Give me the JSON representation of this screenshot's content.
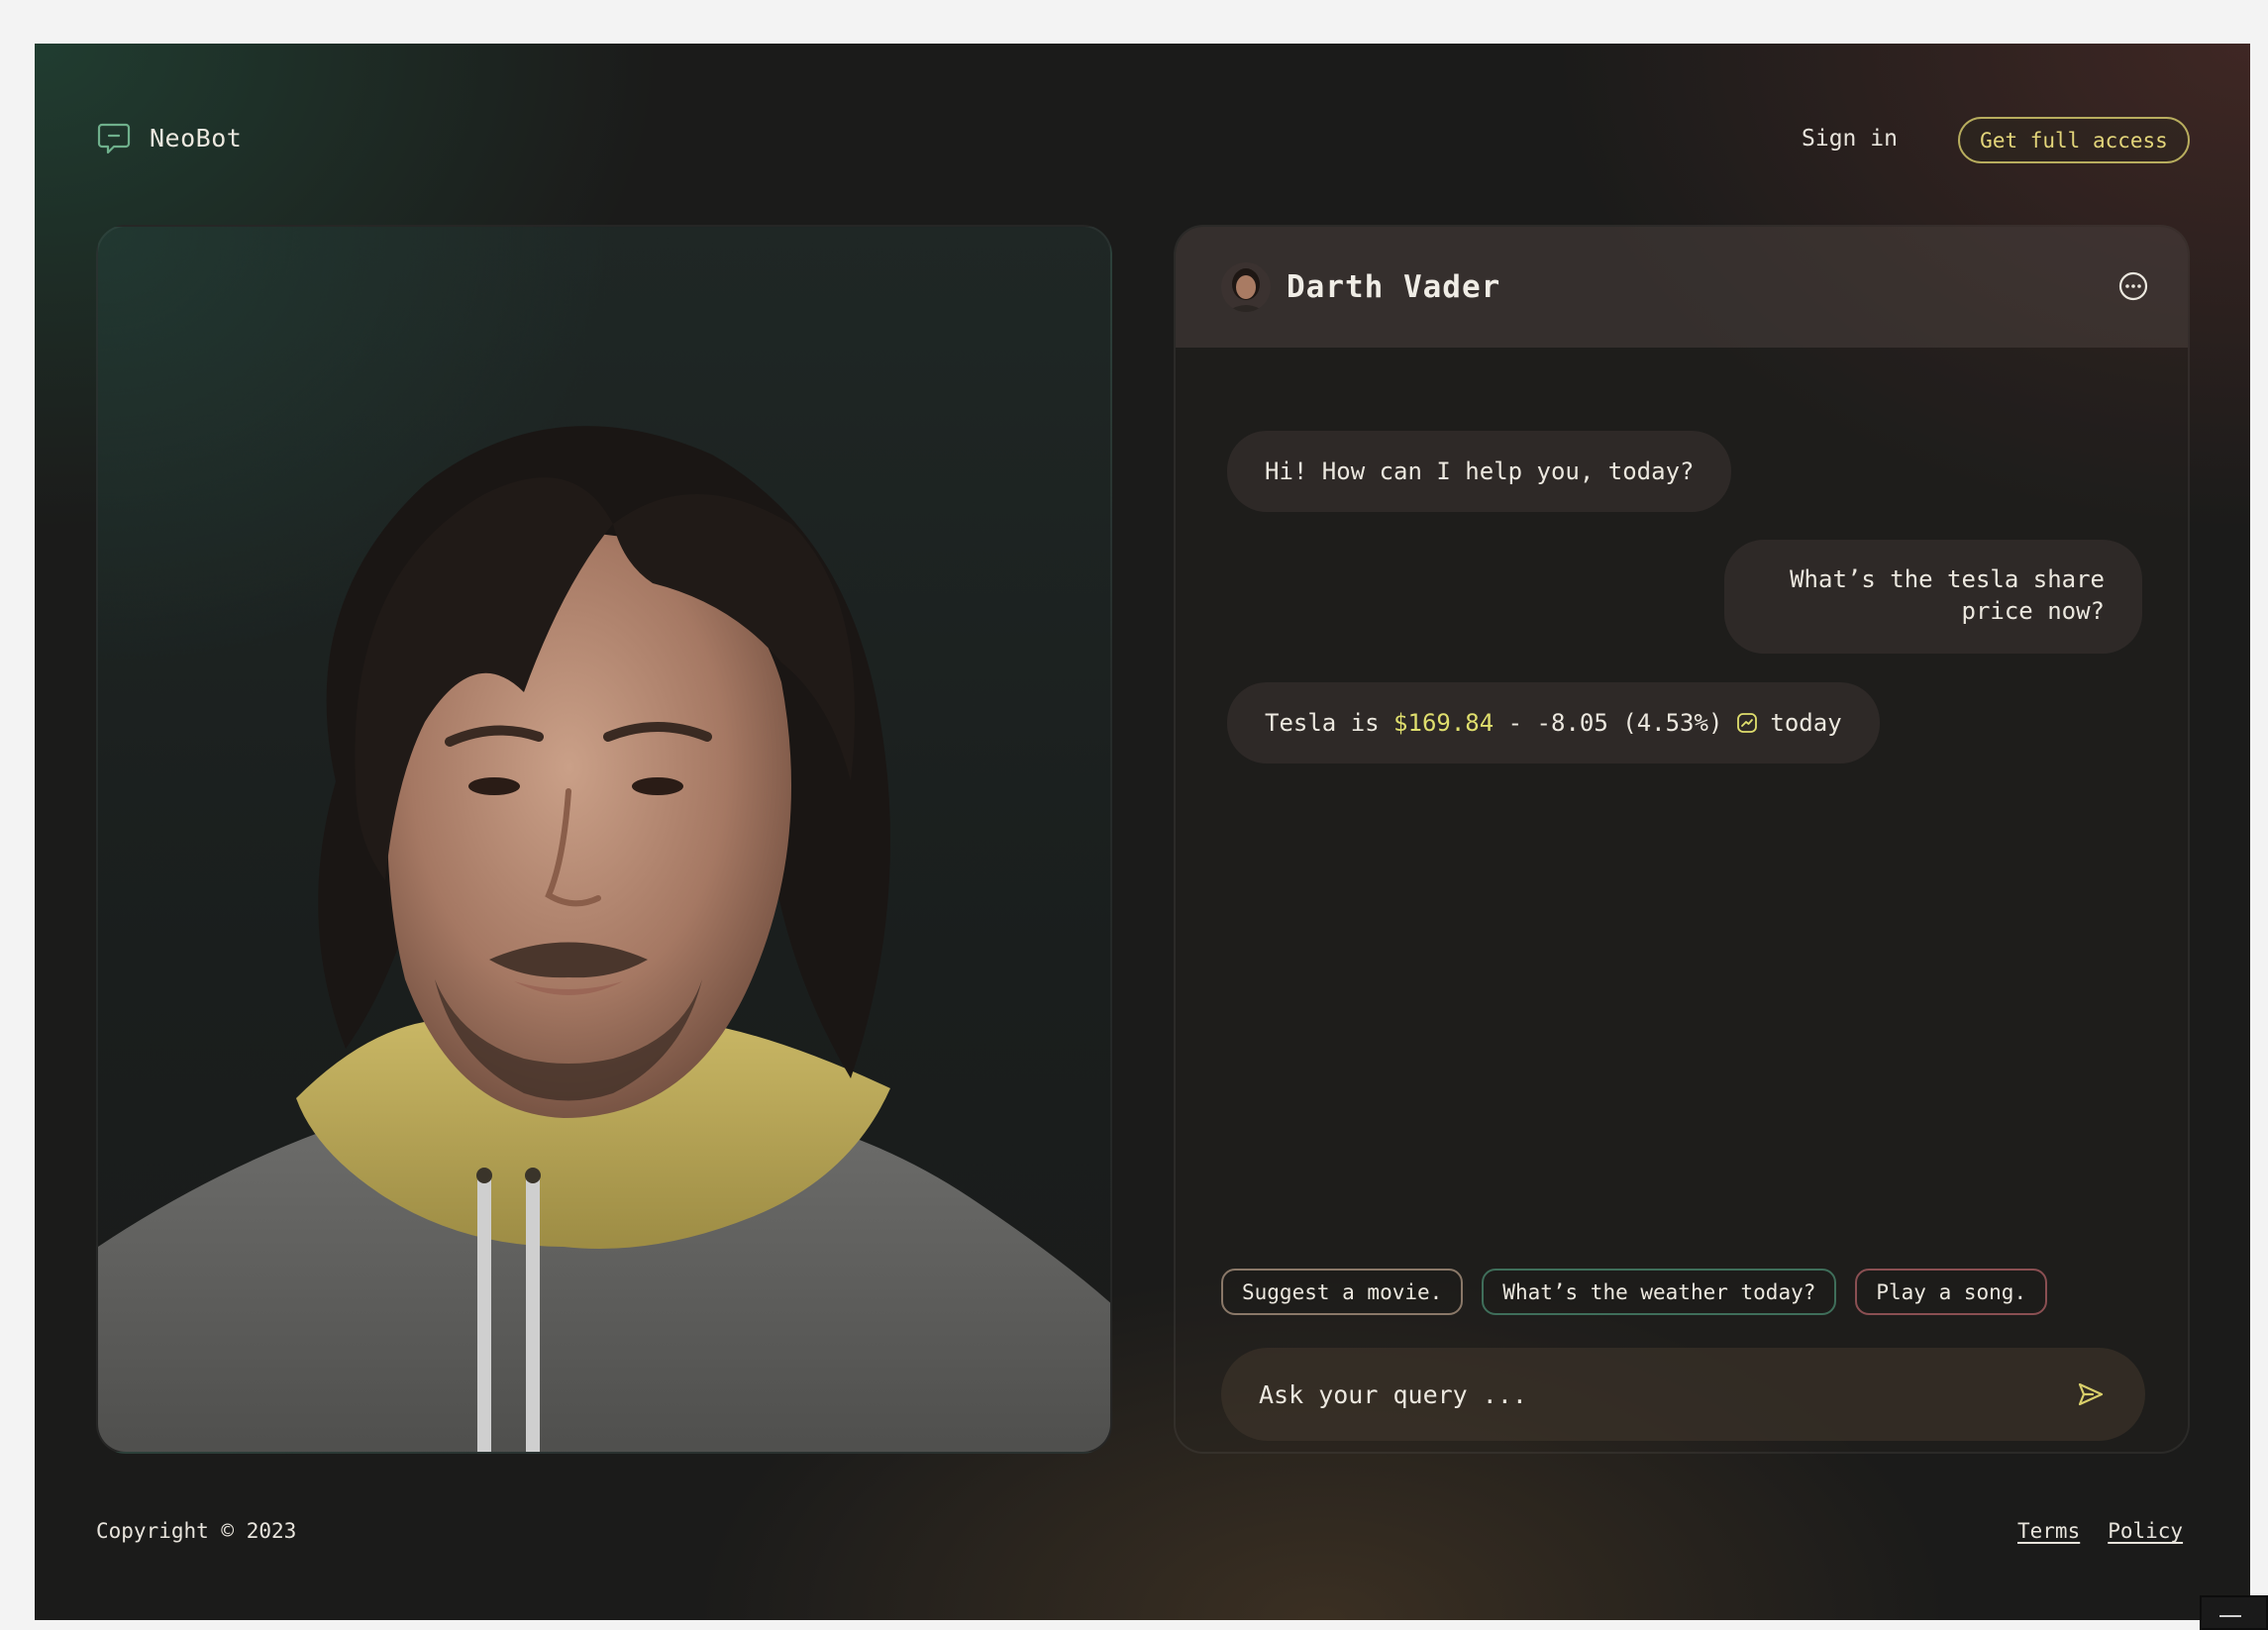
{
  "header": {
    "brand_name": "NeoBot",
    "brand_icon": "chat-bubble-icon",
    "signin_label": "Sign in",
    "access_label": "Get full access"
  },
  "chat": {
    "bot_name": "Darth Vader",
    "more_icon": "more-options-icon",
    "messages": [
      {
        "role": "bot",
        "text": "Hi! How can I help you, today?"
      },
      {
        "role": "user",
        "text": "What’s the tesla share price now?"
      },
      {
        "role": "bot",
        "prefix": "Tesla is ",
        "price": "$169.84",
        "change": " - -8.05 (4.53%)",
        "suffix": "today",
        "icon": "stock-chart-icon"
      }
    ],
    "suggestions": [
      "Suggest a movie.",
      "What’s the weather today?",
      "Play a song."
    ],
    "input": {
      "placeholder": "Ask your query ...",
      "value": "",
      "send_icon": "send-icon"
    }
  },
  "footer": {
    "copyright": "Copyright © 2023",
    "links": [
      "Terms",
      "Policy"
    ]
  },
  "colors": {
    "accent": "#e3d57a",
    "price": "#e0df6e",
    "brand_icon": "#6fb08c",
    "chip_borders": [
      "#8a7868",
      "#3f6e5a",
      "#8a4f52"
    ]
  }
}
